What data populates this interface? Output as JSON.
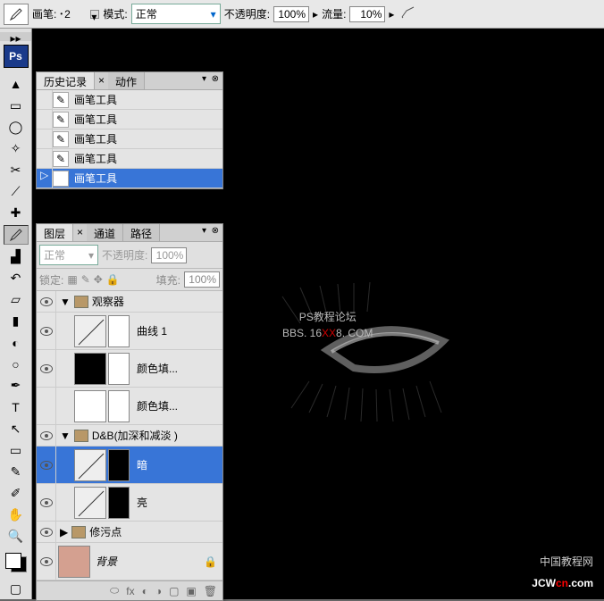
{
  "options_bar": {
    "brush_label": "画笔:",
    "brush_size": "2",
    "mode_label": "模式:",
    "mode_value": "正常",
    "opacity_label": "不透明度:",
    "opacity_value": "100%",
    "flow_label": "流量:",
    "flow_value": "10%"
  },
  "ps_logo": "Ps",
  "history_panel": {
    "tab_history": "历史记录",
    "tab_actions": "动作",
    "items": [
      {
        "label": "画笔工具"
      },
      {
        "label": "画笔工具"
      },
      {
        "label": "画笔工具"
      },
      {
        "label": "画笔工具"
      },
      {
        "label": "画笔工具"
      }
    ]
  },
  "layers_panel": {
    "tab_layers": "图层",
    "tab_channels": "通道",
    "tab_paths": "路径",
    "blend_mode": "正常",
    "opacity_label": "不透明度:",
    "opacity_value": "100%",
    "lock_label": "锁定:",
    "fill_label": "填充:",
    "fill_value": "100%",
    "groups": [
      {
        "name": "观察器"
      },
      {
        "name": "D&B(加深和减淡 )"
      },
      {
        "name": "修污点"
      }
    ],
    "layers": [
      {
        "name": "曲线 1"
      },
      {
        "name": "颜色填..."
      },
      {
        "name": "颜色填..."
      },
      {
        "name": "暗"
      },
      {
        "name": "亮"
      },
      {
        "name": "背景"
      }
    ]
  },
  "watermark_top": {
    "line1": "PS教程论坛",
    "line2_a": "BBS. 16",
    "line2_b": "XX",
    "line2_c": "8. COM"
  },
  "watermark_bottom": {
    "sub": "中国教程网",
    "main_a": "JCW",
    "main_b": "cn",
    "main_c": ".com"
  }
}
